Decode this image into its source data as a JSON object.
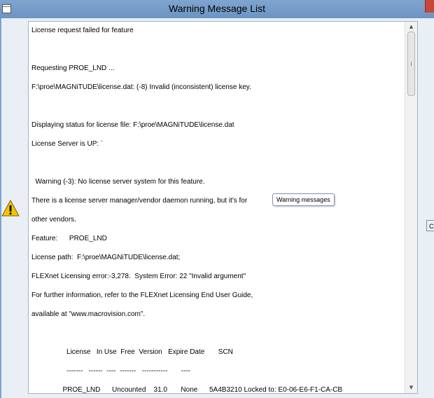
{
  "window": {
    "title": "Warning Message List"
  },
  "messages": [
    "License request failed for feature",
    "",
    "Requesting PROE_LND ...",
    "F:\\proe\\MAGNiTUDE\\license.dat: (-8) Invalid (inconsistent) license key.",
    "",
    "Displaying status for license file: F:\\proe\\MAGNiTUDE\\license.dat",
    "License Server is UP: `",
    "",
    "  Warning (-3): No license server system for this feature.",
    "There is a license server manager/vendor daemon running, but it's for",
    "other vendors.",
    "Feature:      PROE_LND",
    "License path:  F:\\proe\\MAGNiTUDE\\license.dat;",
    "FLEXnet Licensing error:-3,278.  System Error: 22 \"Invalid argument\"",
    "For further information, refer to the FLEXnet Licensing End User Guide,",
    "available at \"www.macrovision.com\".",
    "",
    "                  License   In Use  Free  Version   Expire Date       SCN",
    "                  -------   ------  ----  -------   -----------       ----",
    "                PROE_LND      Uncounted    31.0       None      5A4B3210 Locked to: E0-06-E6-F1-CA-CB"
  ],
  "tooltip": {
    "text": "Warning messages"
  },
  "side_button": {
    "label": "C"
  },
  "colors": {
    "title_bar": "#7fa5cf",
    "warning_icon": "#f5c400"
  },
  "icons": {
    "warning": "warning-triangle-icon"
  }
}
